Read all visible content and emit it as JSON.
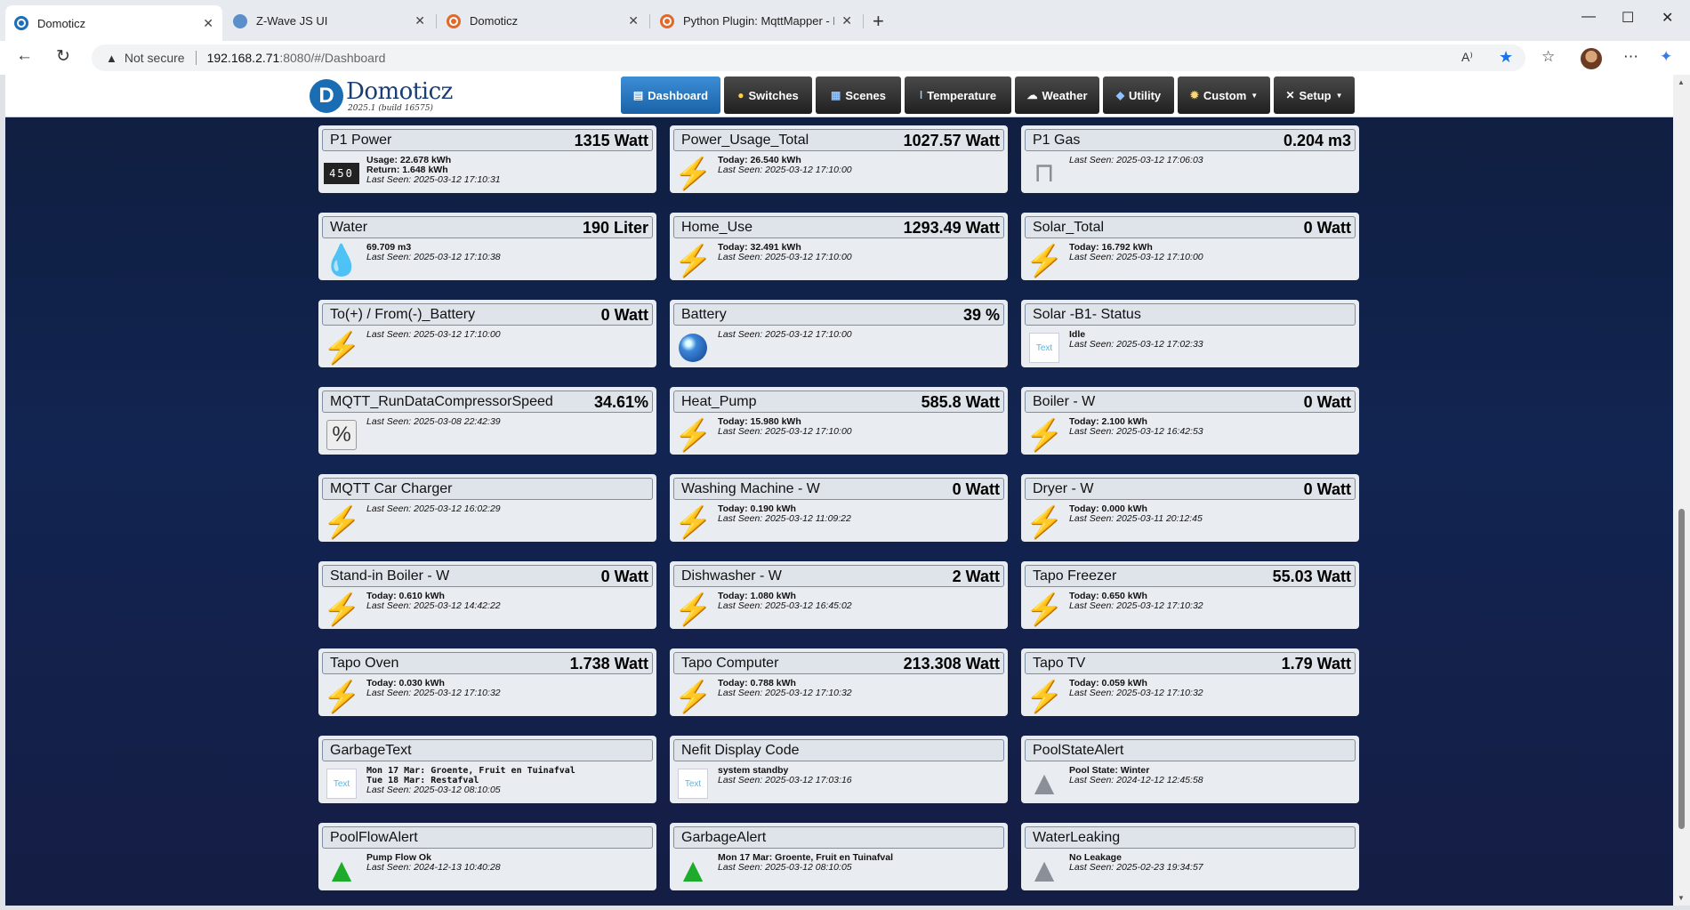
{
  "browser": {
    "tabs": [
      {
        "title": "Domoticz",
        "favicon": "domoticz-icon"
      },
      {
        "title": "Z-Wave JS UI",
        "favicon": "zwave-icon"
      },
      {
        "title": "Domoticz",
        "favicon": "domoticz-icon"
      },
      {
        "title": "Python Plugin: MqttMapper - Pag",
        "favicon": "domoticz-icon"
      }
    ],
    "not_secure": "Not secure",
    "url_host": "192.168.2.71",
    "url_path": ":8080/#/Dashboard"
  },
  "app": {
    "logo_name": "Domoticz",
    "version": "2025.1 (build 16575)",
    "nav": [
      {
        "label": "Dashboard",
        "icon": "dashboard-icon"
      },
      {
        "label": "Switches",
        "icon": "lightbulb-icon"
      },
      {
        "label": "Scenes",
        "icon": "scenes-icon"
      },
      {
        "label": "Temperature",
        "icon": "thermometer-icon"
      },
      {
        "label": "Weather",
        "icon": "cloud-icon"
      },
      {
        "label": "Utility",
        "icon": "utility-icon"
      },
      {
        "label": "Custom",
        "icon": "gear-icon"
      },
      {
        "label": "Setup",
        "icon": "tools-icon"
      }
    ],
    "active_tab": "Dashboard"
  },
  "devices": [
    {
      "name": "P1 Power",
      "value": "1315 Watt",
      "icon": "counter-icon",
      "lines": [
        "Usage: 22.678 kWh",
        "Return: 1.648 kWh"
      ],
      "last_seen": "Last Seen: 2025-03-12 17:10:31"
    },
    {
      "name": "Power_Usage_Total",
      "value": "1027.57 Watt",
      "icon": "lightning-icon",
      "lines": [
        "Today: 26.540 kWh"
      ],
      "last_seen": "Last Seen: 2025-03-12 17:10:00"
    },
    {
      "name": "P1 Gas",
      "value": "0.204 m3",
      "icon": "gas-icon",
      "lines": [],
      "last_seen": "Last Seen: 2025-03-12 17:06:03"
    },
    {
      "name": "Water",
      "value": "190 Liter",
      "icon": "water-drop-icon",
      "lines": [
        "69.709 m3"
      ],
      "last_seen": "Last Seen: 2025-03-12 17:10:38"
    },
    {
      "name": "Home_Use",
      "value": "1293.49 Watt",
      "icon": "lightning-icon",
      "lines": [
        "Today: 32.491 kWh"
      ],
      "last_seen": "Last Seen: 2025-03-12 17:10:00"
    },
    {
      "name": "Solar_Total",
      "value": "0 Watt",
      "icon": "lightning-icon",
      "lines": [
        "Today: 16.792 kWh"
      ],
      "last_seen": "Last Seen: 2025-03-12 17:10:00"
    },
    {
      "name": "To(+) / From(-)_Battery",
      "value": "0 Watt",
      "icon": "lightning-icon",
      "lines": [],
      "last_seen": "Last Seen: 2025-03-12 17:10:00"
    },
    {
      "name": "Battery",
      "value": "39 %",
      "icon": "globe-icon",
      "lines": [],
      "last_seen": "Last Seen: 2025-03-12 17:10:00"
    },
    {
      "name": "Solar -B1- Status",
      "value": "",
      "icon": "text-icon",
      "lines": [
        "Idle"
      ],
      "last_seen": "Last Seen: 2025-03-12 17:02:33"
    },
    {
      "name": "MQTT_RunDataCompressorSpeed",
      "value": "34.61%",
      "icon": "percent-icon",
      "lines": [],
      "last_seen": "Last Seen: 2025-03-08 22:42:39"
    },
    {
      "name": "Heat_Pump",
      "value": "585.8 Watt",
      "icon": "lightning-icon",
      "lines": [
        "Today: 15.980 kWh"
      ],
      "last_seen": "Last Seen: 2025-03-12 17:10:00"
    },
    {
      "name": "Boiler - W",
      "value": "0 Watt",
      "icon": "lightning-icon",
      "lines": [
        "Today: 2.100 kWh"
      ],
      "last_seen": "Last Seen: 2025-03-12 16:42:53"
    },
    {
      "name": "MQTT Car Charger",
      "value": "",
      "icon": "lightning-icon",
      "lines": [],
      "last_seen": "Last Seen: 2025-03-12 16:02:29"
    },
    {
      "name": "Washing Machine - W",
      "value": "0 Watt",
      "icon": "lightning-icon",
      "lines": [
        "Today: 0.190 kWh"
      ],
      "last_seen": "Last Seen: 2025-03-12 11:09:22"
    },
    {
      "name": "Dryer - W",
      "value": "0 Watt",
      "icon": "lightning-icon",
      "lines": [
        "Today: 0.000 kWh"
      ],
      "last_seen": "Last Seen: 2025-03-11 20:12:45"
    },
    {
      "name": "Stand-in Boiler - W",
      "value": "0 Watt",
      "icon": "lightning-icon",
      "lines": [
        "Today: 0.610 kWh"
      ],
      "last_seen": "Last Seen: 2025-03-12 14:42:22"
    },
    {
      "name": "Dishwasher - W",
      "value": "2 Watt",
      "icon": "lightning-icon",
      "lines": [
        "Today: 1.080 kWh"
      ],
      "last_seen": "Last Seen: 2025-03-12 16:45:02"
    },
    {
      "name": "Tapo Freezer",
      "value": "55.03 Watt",
      "icon": "lightning-icon",
      "lines": [
        "Today: 0.650 kWh"
      ],
      "last_seen": "Last Seen: 2025-03-12 17:10:32"
    },
    {
      "name": "Tapo Oven",
      "value": "1.738 Watt",
      "icon": "lightning-icon",
      "lines": [
        "Today: 0.030 kWh"
      ],
      "last_seen": "Last Seen: 2025-03-12 17:10:32"
    },
    {
      "name": "Tapo Computer",
      "value": "213.308 Watt",
      "icon": "lightning-icon",
      "lines": [
        "Today: 0.788 kWh"
      ],
      "last_seen": "Last Seen: 2025-03-12 17:10:32"
    },
    {
      "name": "Tapo TV",
      "value": "1.79 Watt",
      "icon": "lightning-icon",
      "lines": [
        "Today: 0.059 kWh"
      ],
      "last_seen": "Last Seen: 2025-03-12 17:10:32"
    },
    {
      "name": "GarbageText",
      "value": "",
      "icon": "text-icon",
      "mono": true,
      "lines": [
        "Mon 17 Mar: Groente, Fruit en Tuinafval",
        "Tue 18 Mar: Restafval"
      ],
      "last_seen": "Last Seen: 2025-03-12 08:10:05"
    },
    {
      "name": "Nefit Display Code",
      "value": "",
      "icon": "text-icon",
      "lines": [
        "system standby"
      ],
      "last_seen": "Last Seen: 2025-03-12 17:03:16"
    },
    {
      "name": "PoolStateAlert",
      "value": "",
      "icon": "alert-grey-icon",
      "lines": [
        "Pool State: Winter"
      ],
      "last_seen": "Last Seen: 2024-12-12 12:45:58"
    },
    {
      "name": "PoolFlowAlert",
      "value": "",
      "icon": "alert-green-icon",
      "lines": [
        "Pump Flow Ok"
      ],
      "last_seen": "Last Seen: 2024-12-13 10:40:28"
    },
    {
      "name": "GarbageAlert",
      "value": "",
      "icon": "alert-green-icon",
      "lines": [
        "Mon 17 Mar: Groente, Fruit en Tuinafval"
      ],
      "last_seen": "Last Seen: 2025-03-12 08:10:05"
    },
    {
      "name": "WaterLeaking",
      "value": "",
      "icon": "alert-grey-icon",
      "lines": [
        "No Leakage"
      ],
      "last_seen": "Last Seen: 2025-02-23 19:34:57"
    }
  ]
}
